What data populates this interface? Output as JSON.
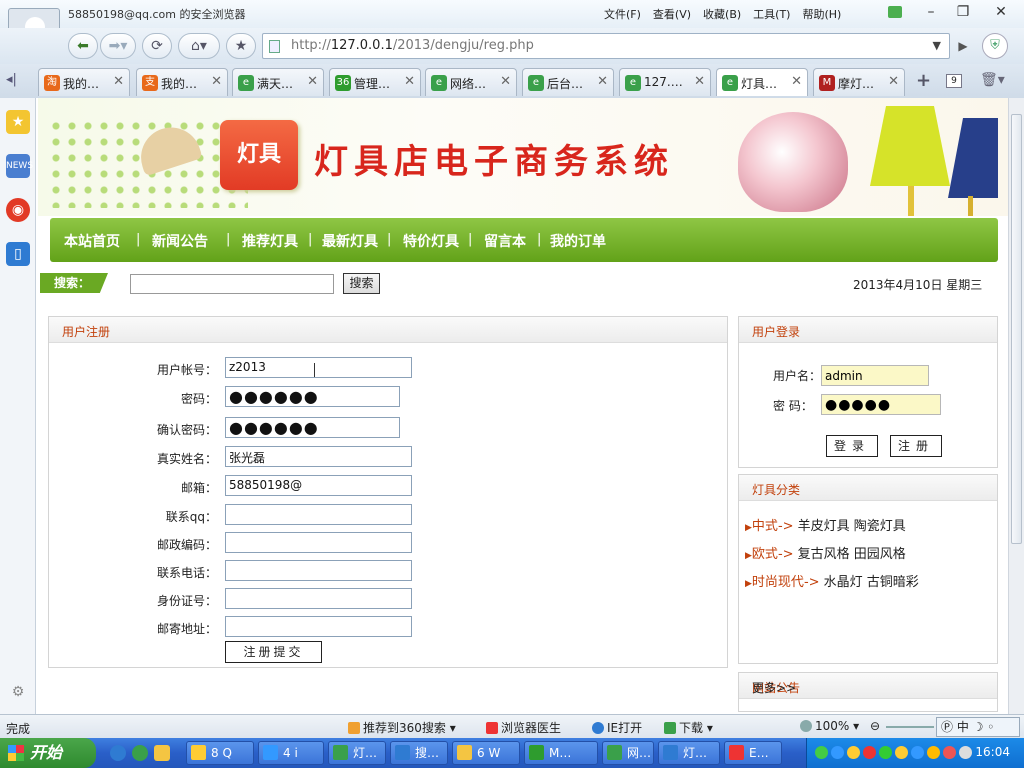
{
  "window": {
    "title": "58850198@qq.com 的安全浏览器",
    "menus": [
      "文件(F)",
      "查看(V)",
      "收藏(B)",
      "工具(T)",
      "帮助(H)"
    ]
  },
  "address": {
    "url_prefix": "http://",
    "url_host": "127.0.0.1",
    "url_path": "/2013/dengju/reg.php"
  },
  "tabs": [
    {
      "label": "我的…",
      "icon_color": "#e8691b",
      "icon": "淘"
    },
    {
      "label": "我的…",
      "icon_color": "#e8691b",
      "icon": "支"
    },
    {
      "label": "满天…",
      "icon_color": "#3aa04a",
      "icon": "e"
    },
    {
      "label": "管理…",
      "icon_color": "#2e9c2e",
      "icon": "36"
    },
    {
      "label": "网络…",
      "icon_color": "#3aa04a",
      "icon": "e"
    },
    {
      "label": "后台…",
      "icon_color": "#3aa04a",
      "icon": "e"
    },
    {
      "label": "127.…",
      "icon_color": "#3aa04a",
      "icon": "e"
    },
    {
      "label": "灯具…",
      "icon_color": "#3aa04a",
      "icon": "e"
    },
    {
      "label": "摩灯…",
      "icon_color": "#b0201f",
      "icon": "M"
    }
  ],
  "tab_count": "9",
  "site": {
    "logo_text": "灯具",
    "title": "灯具店电子商务系统",
    "nav": [
      "本站首页",
      "新闻公告",
      "推荐灯具",
      "最新灯具",
      "特价灯具",
      "留言本",
      "我的订单"
    ],
    "search_label": "搜索：",
    "search_button": "搜索",
    "date": "2013年4月10日  星期三"
  },
  "register": {
    "heading": "用户注册",
    "fields": [
      {
        "label": "用户帐号：",
        "value": "z2013"
      },
      {
        "label": "密码：",
        "value": "●●●●●●"
      },
      {
        "label": "确认密码：",
        "value": "●●●●●●"
      },
      {
        "label": "真实姓名：",
        "value": "张光磊"
      },
      {
        "label": "邮箱：",
        "value": "58850198@"
      },
      {
        "label": "联系qq：",
        "value": ""
      },
      {
        "label": "邮政编码：",
        "value": ""
      },
      {
        "label": "联系电话：",
        "value": ""
      },
      {
        "label": "身份证号：",
        "value": ""
      },
      {
        "label": "邮寄地址：",
        "value": ""
      }
    ],
    "submit": "注册提交"
  },
  "login": {
    "heading": "用户登录",
    "username_label": "用户名：",
    "username": "admin",
    "password_label": "密  码：",
    "password": "●●●●●",
    "login_button": "登录",
    "register_button": "注册"
  },
  "categories": {
    "heading": "灯具分类",
    "items": [
      {
        "name": "中式",
        "subs": "羊皮灯具  陶瓷灯具"
      },
      {
        "name": "欧式",
        "subs": "复古风格  田园风格"
      },
      {
        "name": "时尚现代",
        "subs": "水晶灯  古铜暗彩"
      }
    ]
  },
  "notice": {
    "heading": "网站公告",
    "more": "更多>>"
  },
  "status": {
    "text": "完成",
    "recommend": "推荐到360搜索",
    "doctor": "浏览器医生",
    "ie_open": "IE打开",
    "download": "下载",
    "zoom": "100%",
    "ime": "中"
  },
  "taskbar": {
    "start": "开始",
    "tasks": [
      "8 Q",
      "4 i",
      "灯…",
      "搜…",
      "6 W",
      "M…",
      "网…",
      "灯…",
      "E…"
    ],
    "clock": "16:04"
  }
}
